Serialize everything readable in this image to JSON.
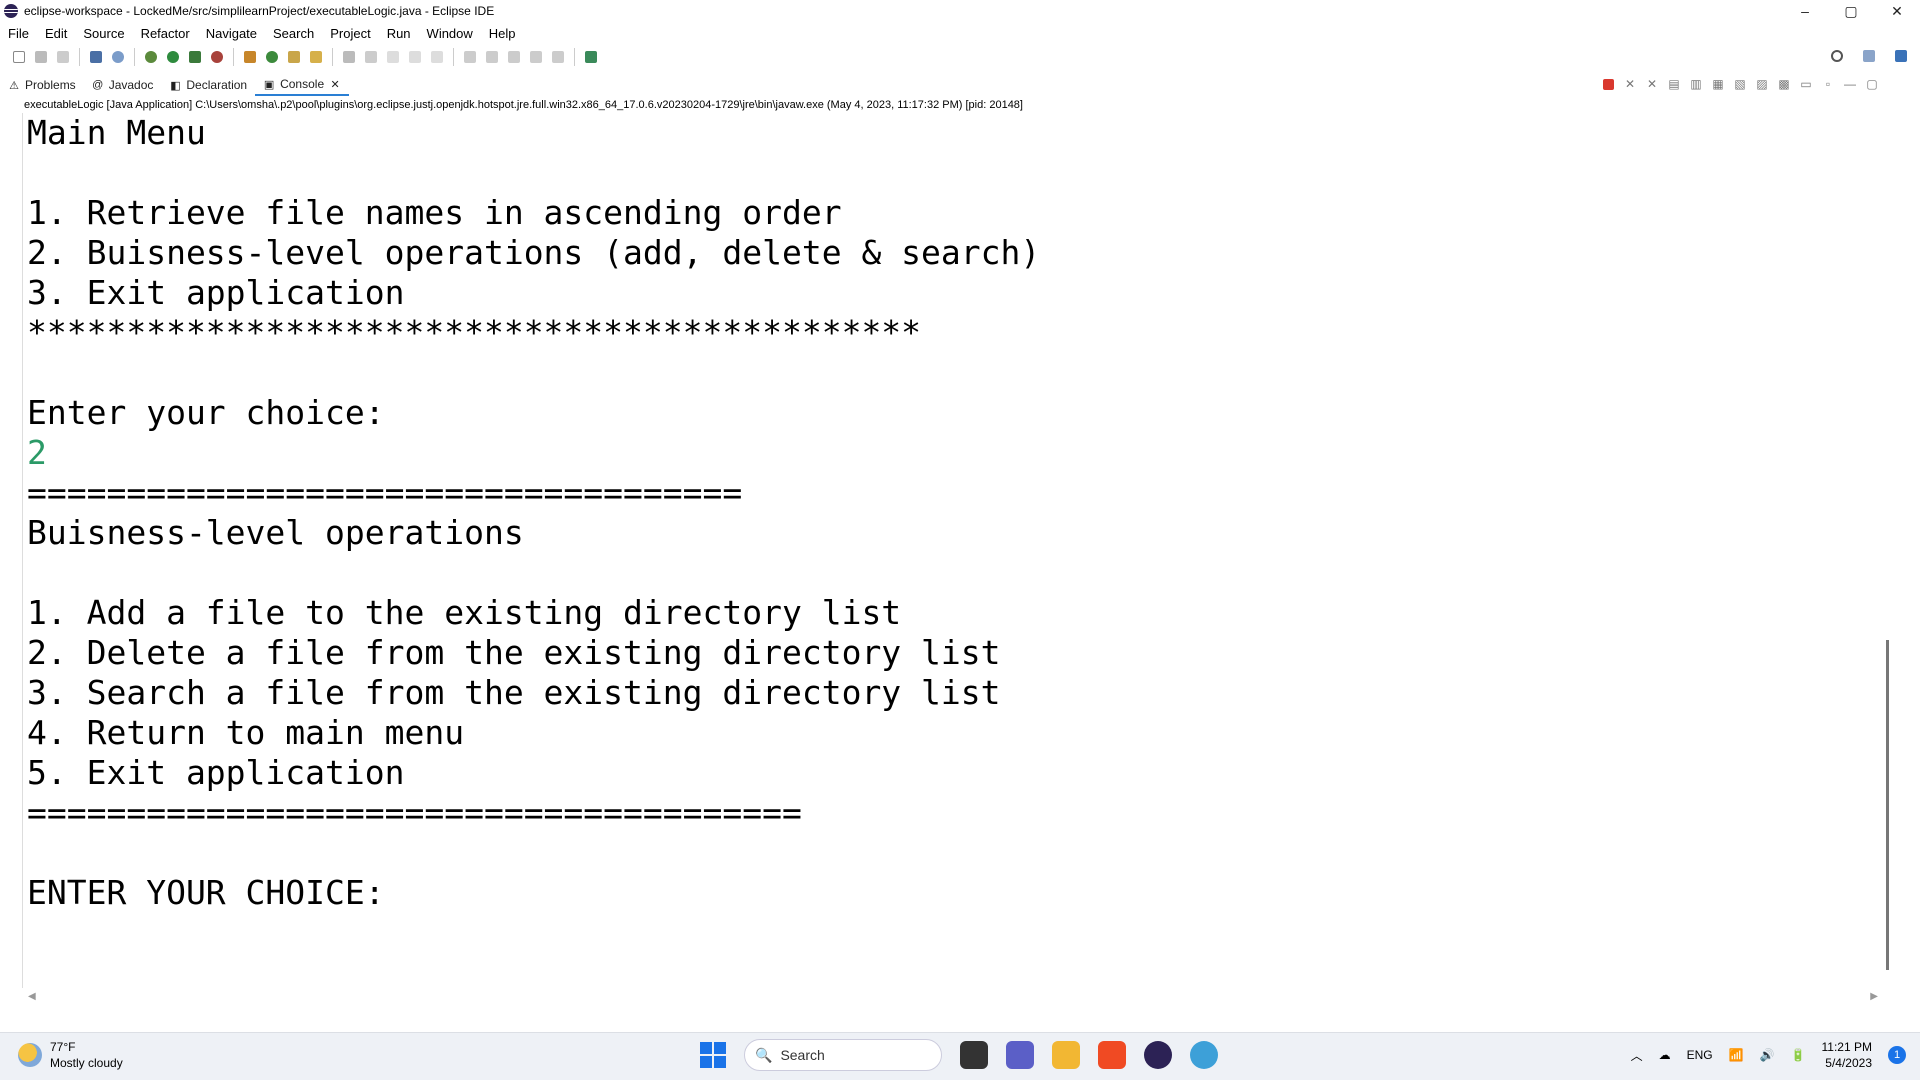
{
  "window": {
    "title": "eclipse-workspace - LockedMe/src/simplilearnProject/executableLogic.java - Eclipse IDE",
    "controls": [
      "–",
      "▢",
      "✕"
    ]
  },
  "menu": [
    "File",
    "Edit",
    "Source",
    "Refactor",
    "Navigate",
    "Search",
    "Project",
    "Run",
    "Window",
    "Help"
  ],
  "views": {
    "tabs": [
      {
        "label": "Problems",
        "icon": "problems-icon"
      },
      {
        "label": "Javadoc",
        "icon": "javadoc-icon"
      },
      {
        "label": "Declaration",
        "icon": "declaration-icon"
      },
      {
        "label": "Console",
        "icon": "console-icon",
        "active": true
      }
    ],
    "close_glyph": "✕"
  },
  "console": {
    "launch_info": "executableLogic [Java Application] C:\\Users\\omsha\\.p2\\pool\\plugins\\org.eclipse.justj.openjdk.hotspot.jre.full.win32.x86_64_17.0.6.v20230204-1729\\jre\\bin\\javaw.exe  (May 4, 2023, 11:17:32 PM) [pid: 20148]",
    "output_top": "Main Menu\n\n1. Retrieve file names in ascending order\n2. Buisness-level operations (add, delete & search)\n3. Exit application\n*********************************************\n\nEnter your choice:",
    "user_input": "2",
    "output_bottom": "====================================\nBuisness-level operations\n\n1. Add a file to the existing directory list\n2. Delete a file from the existing directory list\n3. Search a file from the existing directory list\n4. Return to main menu\n5. Exit application\n=======================================\n\nENTER YOUR CHOICE:"
  },
  "taskbar": {
    "weather_temp": "77°F",
    "weather_desc": "Mostly cloudy",
    "search_label": "Search",
    "lang": "ENG",
    "time": "11:21 PM",
    "date": "5/4/2023",
    "notifications": "1"
  }
}
